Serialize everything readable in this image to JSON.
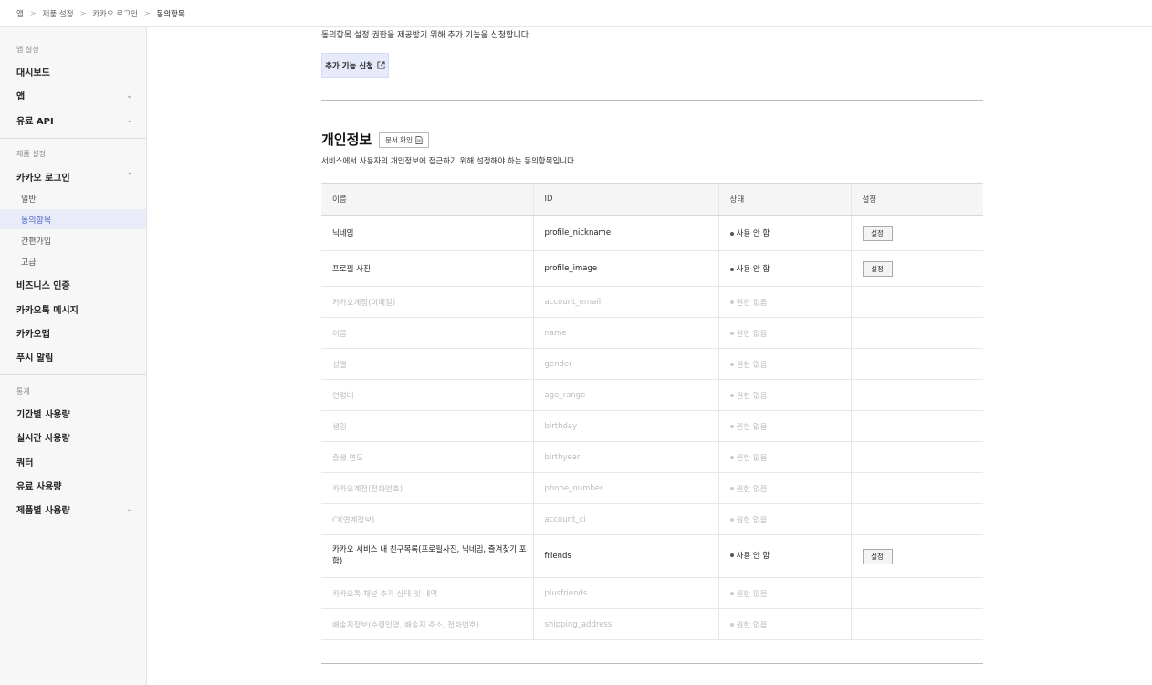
{
  "breadcrumb": [
    "앱",
    "제품 설정",
    "카카오 로그인",
    "동의항목"
  ],
  "sidebar": {
    "sections": {
      "app_settings": "앱 설정",
      "product_settings": "제품 설정",
      "stats": "통계"
    },
    "items": {
      "dashboard": "대시보드",
      "app": "앱",
      "paid_api": "유료 API",
      "kakao_login": "카카오 로그인",
      "general": "일반",
      "consent": "동의항목",
      "simple_signup": "간편가입",
      "advanced": "고급",
      "biz_auth": "비즈니스 인증",
      "kakaotalk_message": "카카오톡 메시지",
      "kakao_map": "카카오맵",
      "push": "푸시 알림",
      "period_usage": "기간별 사용량",
      "realtime_usage": "실시간 사용량",
      "quota": "쿼터",
      "paid_usage": "유료 사용량",
      "product_usage": "제품별 사용량"
    }
  },
  "main": {
    "intro": "동의항목 설정 권한을 제공받기 위해 추가 기능을 신청합니다.",
    "apply_button": "추가 기능 신청",
    "section_title": "개인정보",
    "doc_button": "문서 확인",
    "section_desc": "서비스에서 사용자의 개인정보에 접근하기 위해 설정해야 하는 동의항목입니다.",
    "table": {
      "headers": [
        "이름",
        "ID",
        "상태",
        "설정"
      ],
      "rows": [
        {
          "name": "닉네임",
          "id": "profile_nickname",
          "status": "사용 안 함",
          "setting": "설정"
        },
        {
          "name": "프로필 사진",
          "id": "profile_image",
          "status": "사용 안 함",
          "setting": "설정"
        },
        {
          "name": "카카오계정(이메일)",
          "id": "account_email",
          "status": "권한 없음",
          "setting": ""
        },
        {
          "name": "이름",
          "id": "name",
          "status": "권한 없음",
          "setting": ""
        },
        {
          "name": "성별",
          "id": "gender",
          "status": "권한 없음",
          "setting": ""
        },
        {
          "name": "연령대",
          "id": "age_range",
          "status": "권한 없음",
          "setting": ""
        },
        {
          "name": "생일",
          "id": "birthday",
          "status": "권한 없음",
          "setting": ""
        },
        {
          "name": "출생 연도",
          "id": "birthyear",
          "status": "권한 없음",
          "setting": ""
        },
        {
          "name": "카카오계정(전화번호)",
          "id": "phone_number",
          "status": "권한 없음",
          "setting": ""
        },
        {
          "name": "CI(연계정보)",
          "id": "account_ci",
          "status": "권한 없음",
          "setting": ""
        },
        {
          "name": "카카오 서비스 내 친구목록(프로필사진, 닉네임, 즐겨찾기 포함)",
          "id": "friends",
          "status": "사용 안 함",
          "setting": "설정"
        },
        {
          "name": "카카오톡 채널 추가 상태 및 내역",
          "id": "plusfriends",
          "status": "권한 없음",
          "setting": ""
        },
        {
          "name": "배송지정보(수령인명, 배송지 주소, 전화번호)",
          "id": "shipping_address",
          "status": "권한 없음",
          "setting": ""
        }
      ]
    }
  }
}
